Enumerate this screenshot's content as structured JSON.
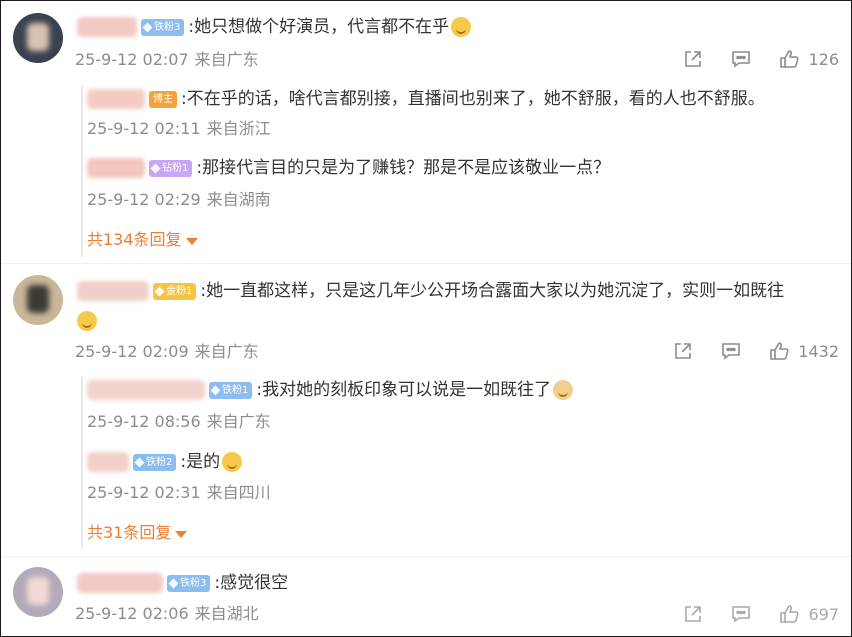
{
  "comments": [
    {
      "badge": "铁粉3",
      "text": ":她只想做个好演员，代言都不在乎",
      "time": "25-9-12 02:07",
      "location": "来自广东",
      "likes": "126",
      "replies": [
        {
          "badge": "博主",
          "text": ":不在乎的话，啥代言都别接，直播间也别来了，她不舒服，看的人也不舒服。",
          "time": "25-9-12 02:11",
          "location": "来自浙江"
        },
        {
          "badge": "钻粉1",
          "text": ":那接代言目的只是为了赚钱？那是不是应该敬业一点？",
          "time": "25-9-12 02:29",
          "location": "来自湖南"
        }
      ],
      "more_replies": "共134条回复"
    },
    {
      "badge": "金粉1",
      "text": ":她一直都这样，只是这几年少公开场合露面大家以为她沉淀了，实则一如既往",
      "time": "25-9-12 02:09",
      "location": "来自广东",
      "likes": "1432",
      "replies": [
        {
          "badge": "铁粉1",
          "text": ":我对她的刻板印象可以说是一如既往了",
          "time": "25-9-12 08:56",
          "location": "来自广东"
        },
        {
          "badge": "铁粉2",
          "text": ":是的",
          "time": "25-9-12 02:31",
          "location": "来自四川"
        }
      ],
      "more_replies": "共31条回复"
    },
    {
      "badge": "铁粉3",
      "text": ":感觉很空",
      "time": "25-9-12 02:06",
      "location": "来自湖北",
      "likes": "697",
      "replies": []
    }
  ],
  "icons": [
    "share-icon",
    "comment-icon",
    "like-icon",
    "chevron-down-icon"
  ],
  "colors": {
    "accent": "#ee7d2f",
    "meta": "#8c8c8c",
    "iron_badge": "#8cbdf0",
    "diamond_badge": "#c7a6f5",
    "gold_badge": "#f5c542",
    "host_badge": "#f4a33a"
  }
}
